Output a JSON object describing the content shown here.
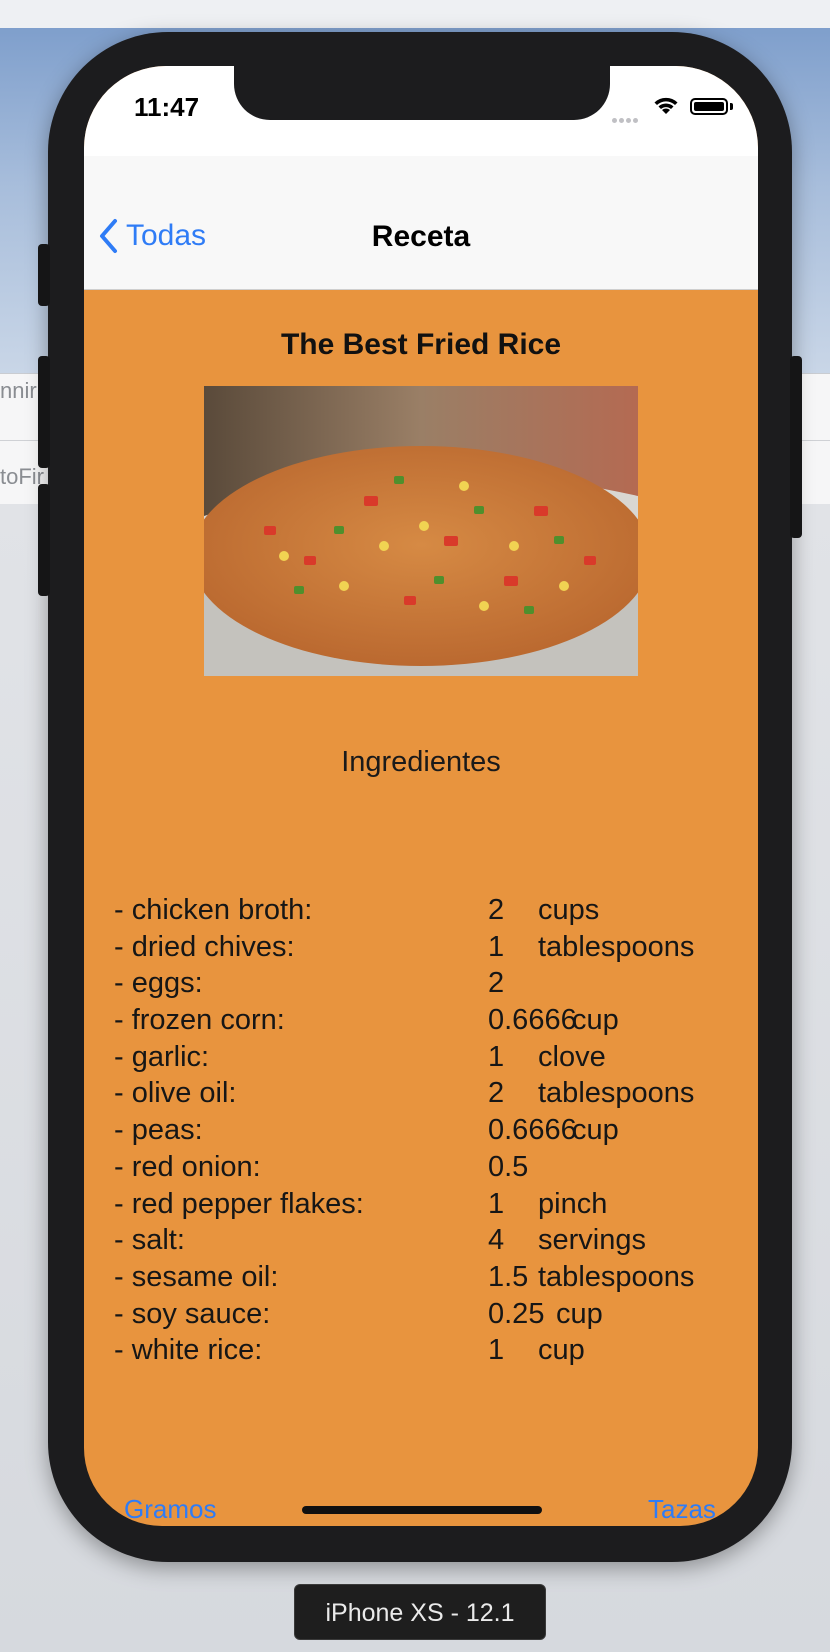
{
  "background": {
    "left_text_1": "nnir",
    "left_text_2": "toFir"
  },
  "status_bar": {
    "time": "11:47",
    "icons": [
      "cellular-signal-icon",
      "wifi-icon",
      "battery-icon"
    ]
  },
  "nav_bar": {
    "back_label": "Todas",
    "title": "Receta"
  },
  "recipe": {
    "title": "The Best Fried Rice",
    "image_alt": "fried-rice-photo",
    "ingredients_heading": "Ingredientes",
    "ingredients": [
      {
        "name": "- chicken broth:",
        "qty": "2",
        "unit": "cups"
      },
      {
        "name": "- dried chives:",
        "qty": "1",
        "unit": "tablespoons"
      },
      {
        "name": "- eggs:",
        "qty": "2",
        "unit": ""
      },
      {
        "name": "- frozen corn:",
        "qty": "0.6666",
        "unit": "cup"
      },
      {
        "name": "- garlic:",
        "qty": "1",
        "unit": "clove"
      },
      {
        "name": "- olive oil:",
        "qty": "2",
        "unit": "tablespoons"
      },
      {
        "name": "- peas:",
        "qty": "0.6666",
        "unit": "cup"
      },
      {
        "name": "- red onion:",
        "qty": "0.5",
        "unit": ""
      },
      {
        "name": "- red pepper flakes:",
        "qty": "1",
        "unit": "pinch"
      },
      {
        "name": "- salt:",
        "qty": "4",
        "unit": "servings"
      },
      {
        "name": "- sesame oil:",
        "qty": "1.5",
        "unit": "tablespoons"
      },
      {
        "name": "- soy sauce:",
        "qty": "0.25",
        "unit": "cup"
      },
      {
        "name": "- white rice:",
        "qty": "1",
        "unit": "cup"
      }
    ]
  },
  "bottom_toolbar": {
    "left_button": "Gramos",
    "right_button": "Tazas"
  },
  "simulator": {
    "device_label": "iPhone XS - 12.1"
  },
  "colors": {
    "accent": "#2f7cf6",
    "content_background": "#e8943e",
    "device_frame": "#1c1c1e"
  }
}
